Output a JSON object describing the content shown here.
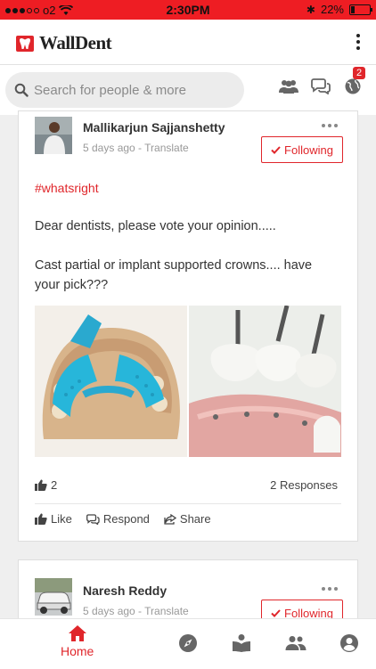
{
  "status": {
    "carrier": "o2",
    "time": "2:30PM",
    "battery": "22%"
  },
  "header": {
    "app_name": "WallDent"
  },
  "search": {
    "placeholder": "Search for people & more"
  },
  "notifications": {
    "count": "2"
  },
  "posts": [
    {
      "author": "Mallikarjun Sajjanshetty",
      "meta": "5 days ago - Translate",
      "follow_label": "Following",
      "hashtag": "#whatsright",
      "text1": "Dear dentists, please vote your opinion.....",
      "text2": "Cast partial or implant supported crowns.... have your pick???",
      "likes": "2",
      "responses": "2 Responses",
      "actions": {
        "like": "Like",
        "respond": "Respond",
        "share": "Share"
      }
    },
    {
      "author": "Naresh Reddy",
      "meta": "5 days ago - Translate",
      "follow_label": "Following"
    }
  ],
  "bottom_nav": {
    "home": "Home"
  },
  "colors": {
    "accent": "#e0262b",
    "status_bar": "#ee1d23"
  }
}
